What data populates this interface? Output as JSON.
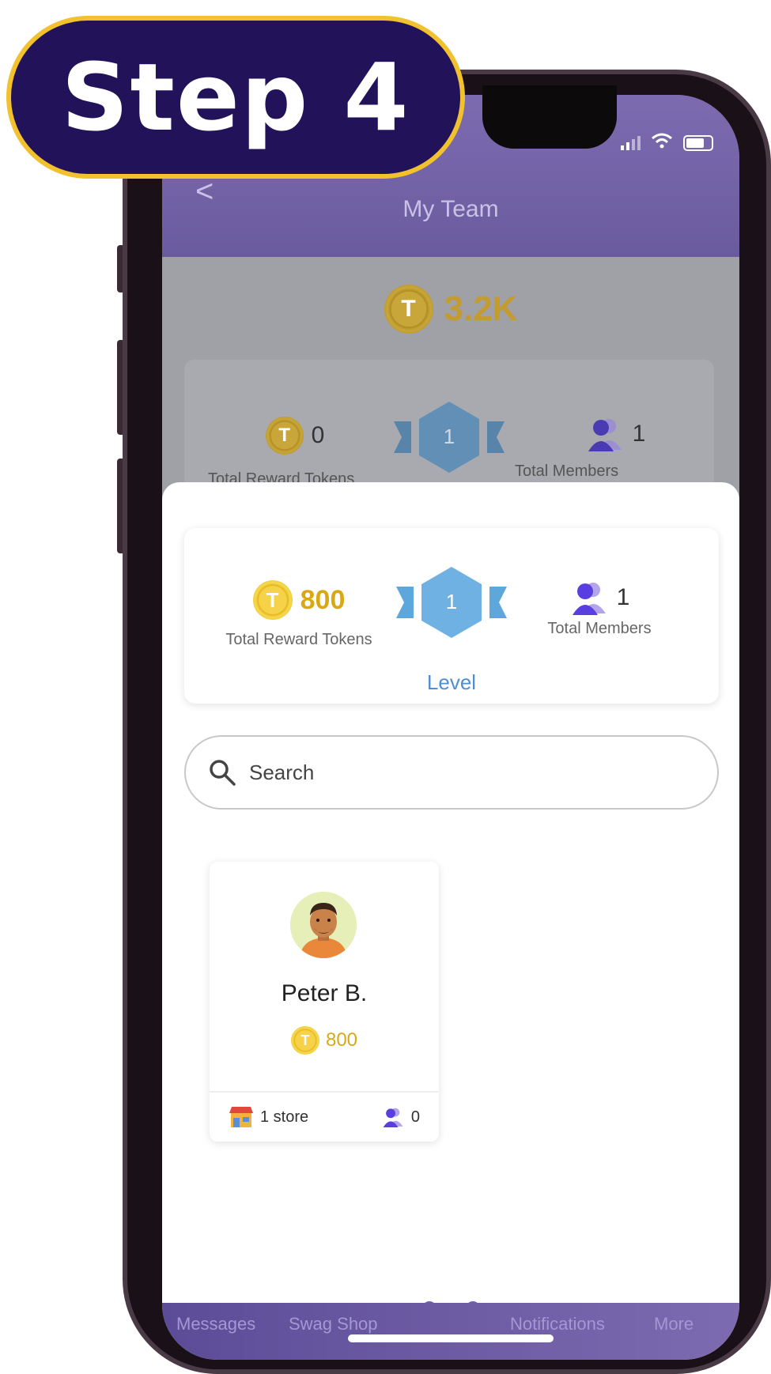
{
  "badge": {
    "step_label": "Step 4"
  },
  "header": {
    "back_glyph": "<",
    "title": "My Team"
  },
  "balance": {
    "amount": "3.2K",
    "icon": "token-coin-icon"
  },
  "background_stats": {
    "tokens_value": "0",
    "tokens_label": "Total Reward Tokens",
    "level_value": "1",
    "members_value": "1",
    "members_label": "Total Members"
  },
  "stats": {
    "tokens_value": "800",
    "tokens_label": "Total Reward Tokens",
    "level_value": "1",
    "level_label": "Level",
    "members_value": "1",
    "members_label": "Total Members"
  },
  "search": {
    "placeholder": "Search"
  },
  "members": [
    {
      "name": "Peter B.",
      "tokens": "800",
      "stores": "1 store",
      "members_count": "0"
    }
  ],
  "tabs": [
    "Messages",
    "Swag Shop",
    "Notifications",
    "More"
  ],
  "colors": {
    "badge_bg": "#22125a",
    "badge_border": "#f2c12e",
    "header_purple": "#7d6bb0",
    "gold": "#d9a915",
    "level_blue": "#5ea7db",
    "dot_active": "#6d5cc2"
  },
  "pagination": {
    "pages": 3,
    "active_index": 0
  }
}
